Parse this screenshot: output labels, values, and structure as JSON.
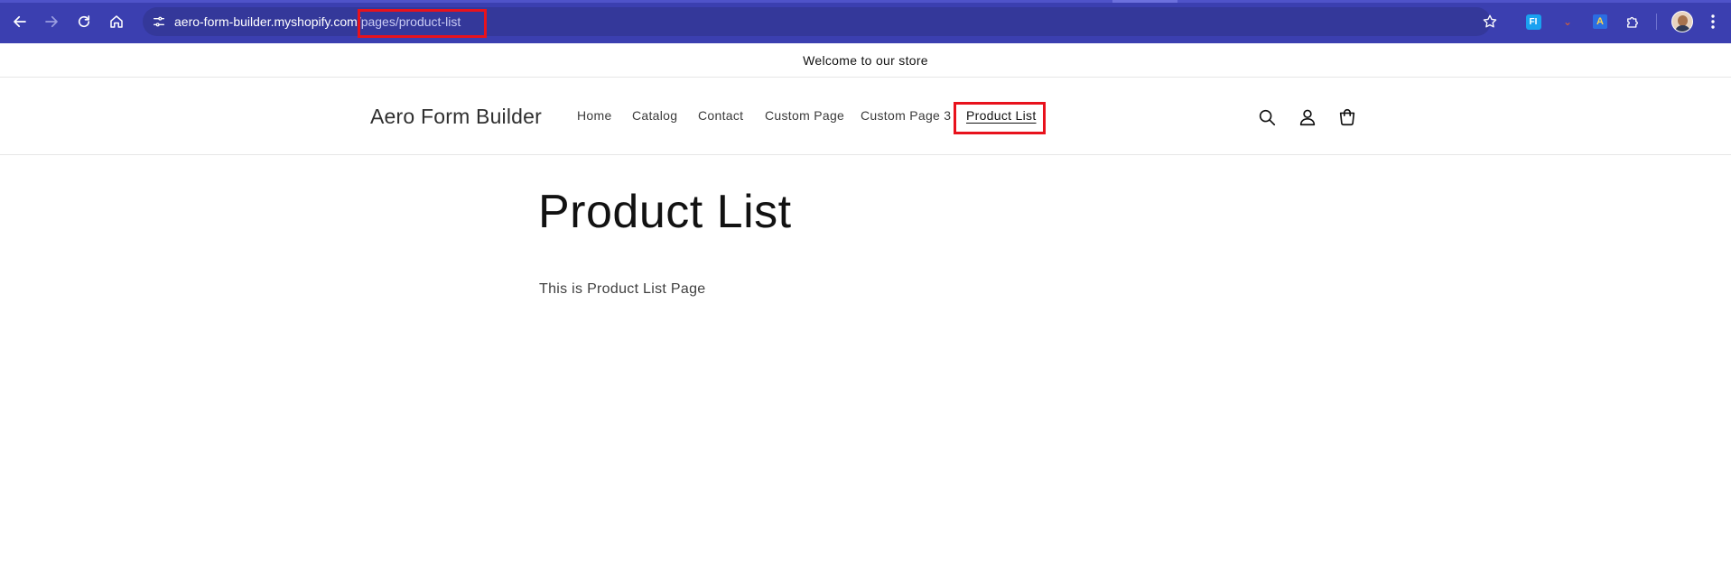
{
  "browser": {
    "url_host": "aero-form-builder.myshopify.com",
    "url_path": "/pages/product-list",
    "extensions": {
      "fi_label": "FI",
      "a_label": "A"
    },
    "icons": {
      "back": "arrow-left-icon",
      "forward": "arrow-right-icon",
      "reload": "reload-icon",
      "home": "home-icon",
      "site_info": "tune-icon",
      "bookmark": "star-icon",
      "extensions": "puzzle-icon",
      "menu": "more-vert-icon"
    }
  },
  "store": {
    "announcement": "Welcome to our store",
    "logo": "Aero Form Builder",
    "nav": [
      {
        "label": "Home"
      },
      {
        "label": "Catalog"
      },
      {
        "label": "Contact"
      },
      {
        "label": "Custom Page"
      },
      {
        "label": "Custom Page 3"
      },
      {
        "label": "Product List",
        "active": true
      }
    ],
    "header_icons": [
      "search-icon",
      "account-icon",
      "cart-icon"
    ]
  },
  "page": {
    "title": "Product List",
    "content": "This is Product List Page"
  },
  "colors": {
    "chrome_bg": "#3b3fb0",
    "omnibox_bg": "#34389a",
    "highlight": "#e8121c",
    "text": "#121212"
  }
}
